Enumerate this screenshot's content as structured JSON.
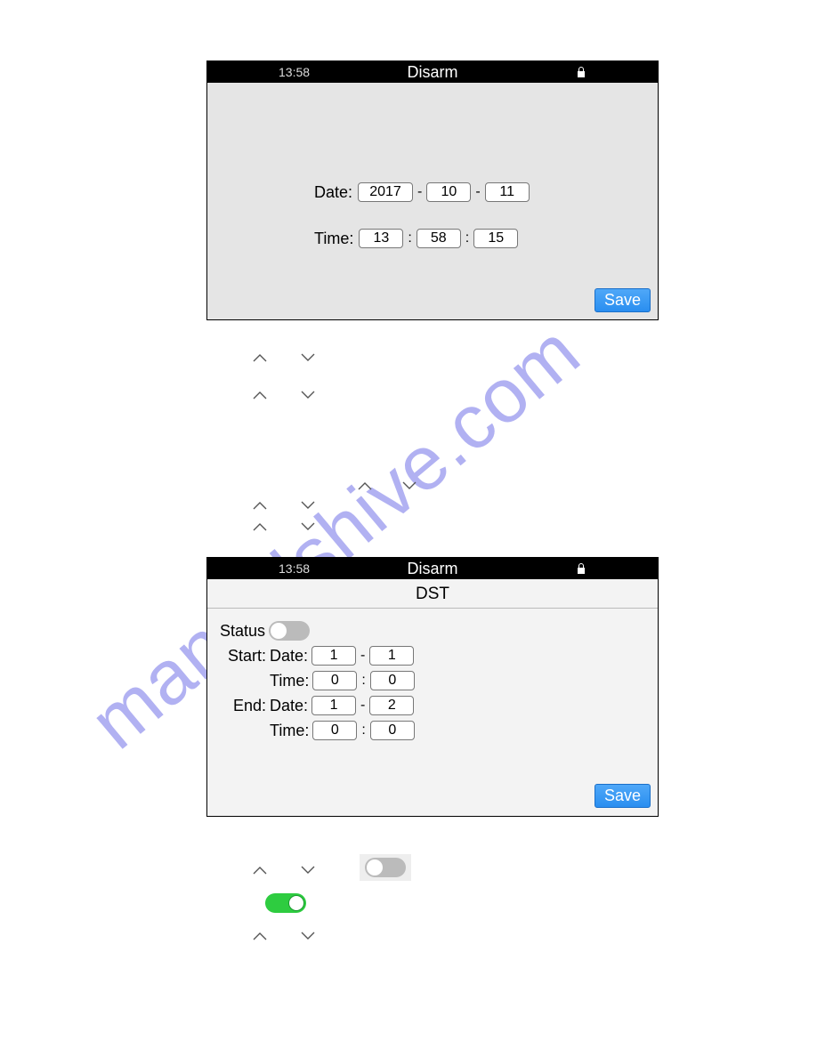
{
  "watermark_text": "manualshive.com",
  "screen1": {
    "status": {
      "time": "13:58",
      "title": "Disarm"
    },
    "date": {
      "label": "Date:",
      "year": "2017",
      "month": "10",
      "day": "11"
    },
    "time": {
      "label": "Time:",
      "hour": "13",
      "minute": "58",
      "second": "15"
    },
    "save_label": "Save",
    "sep_dash": "-",
    "sep_colon": ":"
  },
  "screen2": {
    "status": {
      "time": "13:58",
      "title": "Disarm"
    },
    "header": "DST",
    "status_label": "Status",
    "start_label": "Start:",
    "end_label": "End:",
    "date_label": "Date:",
    "time_label": "Time:",
    "start_date": {
      "m": "1",
      "d": "1"
    },
    "start_time": {
      "h": "0",
      "m": "0"
    },
    "end_date": {
      "m": "1",
      "d": "2"
    },
    "end_time": {
      "h": "0",
      "m": "0"
    },
    "save_label": "Save",
    "sep_dash": "-",
    "sep_colon": ":"
  }
}
